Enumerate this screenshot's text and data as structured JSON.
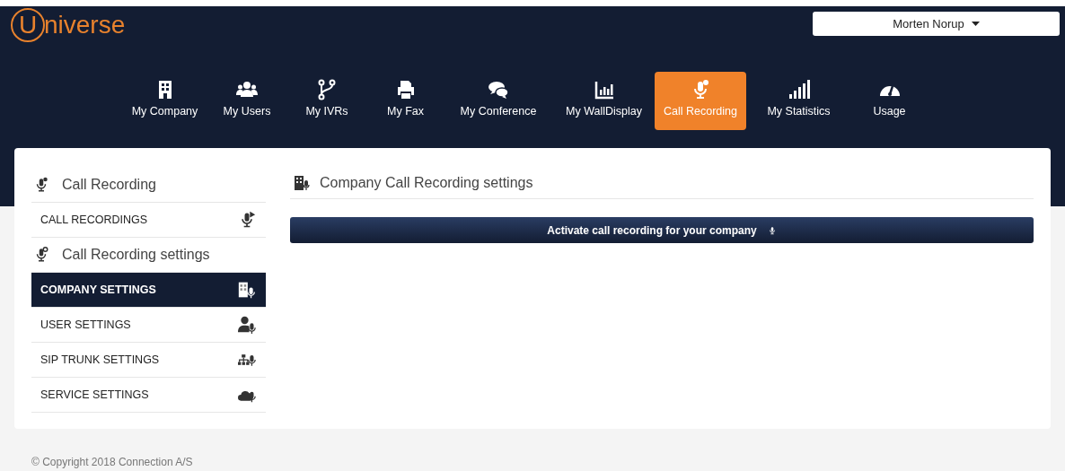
{
  "logo": {
    "letter": "U",
    "rest": "niverse"
  },
  "user_menu": {
    "name": "Morten Norup"
  },
  "nav": [
    {
      "label": "My Company",
      "selected": false
    },
    {
      "label": "My Users",
      "selected": false
    },
    {
      "label": "My IVRs",
      "selected": false
    },
    {
      "label": "My Fax",
      "selected": false
    },
    {
      "label": "My Conference",
      "selected": false
    },
    {
      "label": "My WallDisplay",
      "selected": false
    },
    {
      "label": "Call Recording",
      "selected": true
    },
    {
      "label": "My Statistics",
      "selected": false
    },
    {
      "label": "Usage",
      "selected": false
    }
  ],
  "sidebar": [
    {
      "heading": "Call Recording",
      "items": [
        {
          "label": "CALL RECORDINGS",
          "selected": false
        }
      ]
    },
    {
      "heading": "Call Recording settings",
      "items": [
        {
          "label": "COMPANY SETTINGS",
          "selected": true
        },
        {
          "label": "USER SETTINGS",
          "selected": false
        },
        {
          "label": "SIP TRUNK SETTINGS",
          "selected": false
        },
        {
          "label": "SERVICE SETTINGS",
          "selected": false
        }
      ]
    }
  ],
  "content": {
    "title": "Company Call Recording settings",
    "action_button": "Activate call recording for your company"
  },
  "footer": "© Copyright 2018 Connection A/S"
}
